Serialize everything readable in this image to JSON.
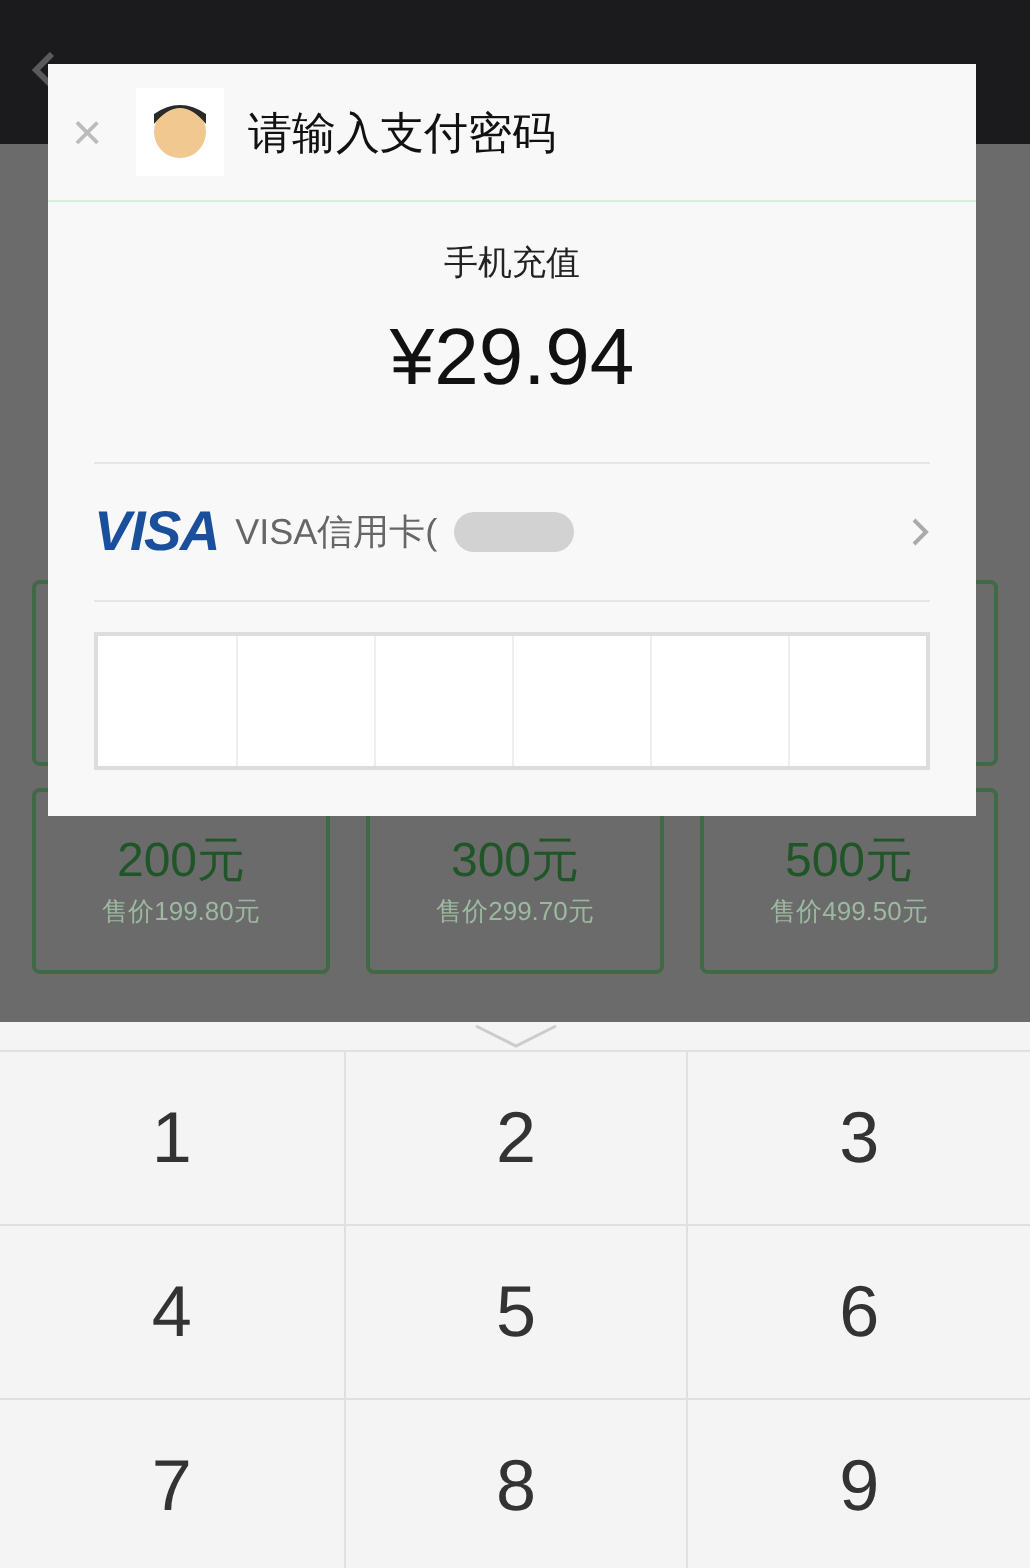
{
  "tiles": [
    {
      "amount": "200元",
      "price": "售价199.80元"
    },
    {
      "amount": "300元",
      "price": "售价299.70元"
    },
    {
      "amount": "500元",
      "price": "售价499.50元"
    }
  ],
  "dialog": {
    "close": "×",
    "title": "请输入支付密码",
    "item": "手机充值",
    "amount": "¥29.94",
    "card_brand": "VISA",
    "card_label": "VISA信用卡("
  },
  "keypad": {
    "keys": [
      "1",
      "2",
      "3",
      "4",
      "5",
      "6",
      "7",
      "8",
      "9"
    ]
  }
}
